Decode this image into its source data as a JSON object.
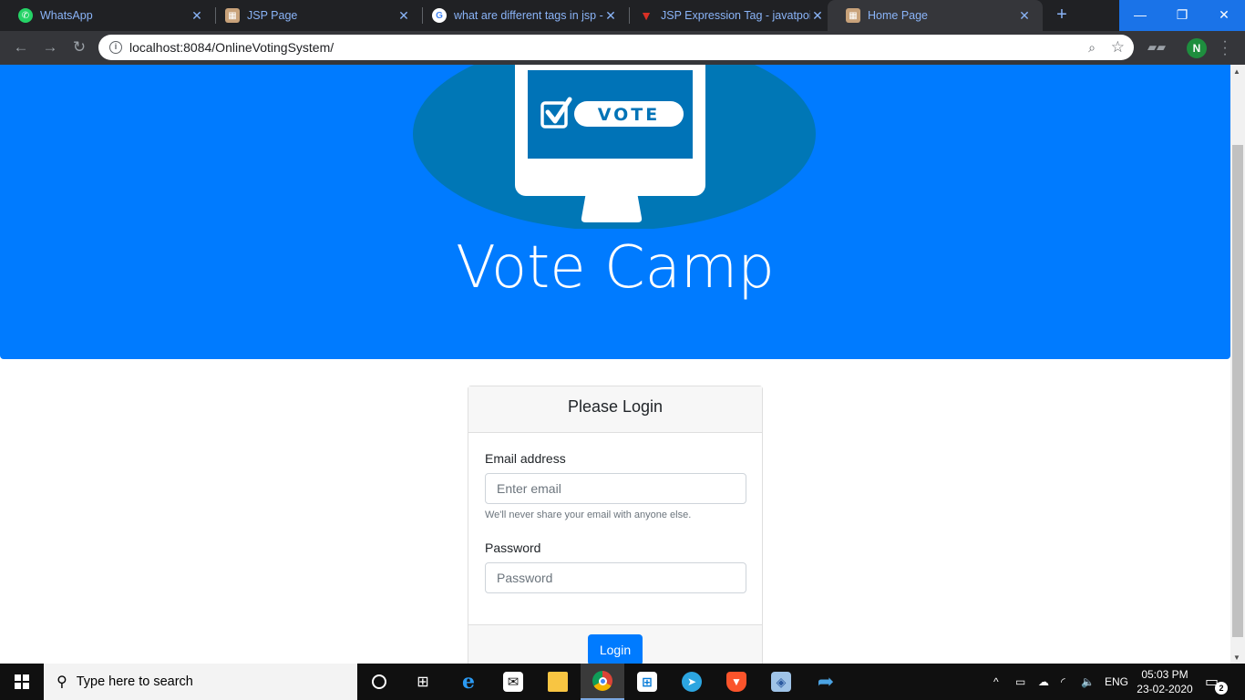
{
  "browser": {
    "tabs": [
      {
        "title": "WhatsApp",
        "icon": "whatsapp-icon",
        "color": "#25d366"
      },
      {
        "title": "JSP Page",
        "icon": "page-icon",
        "color": "#c8a27a"
      },
      {
        "title": "what are different tags in jsp -",
        "icon": "google-icon",
        "color": "#ffffff"
      },
      {
        "title": "JSP Expression Tag - javatpoint",
        "icon": "javatpoint-icon",
        "color": "#d93025"
      },
      {
        "title": "Home Page",
        "icon": "page-icon",
        "color": "#c8a27a"
      }
    ],
    "new_tab": "+",
    "window": {
      "minimize": "—",
      "maximize": "❐",
      "close": "✕"
    },
    "address": {
      "url": "localhost:8084/OnlineVotingSystem/"
    },
    "profile_initial": "N"
  },
  "page": {
    "logo_text": "VOTE",
    "brand": "Vote Camp",
    "login": {
      "header": "Please Login",
      "email_label": "Email address",
      "email_placeholder": "Enter email",
      "email_help": "We'll never share your email with anyone else.",
      "password_label": "Password",
      "password_placeholder": "Password",
      "submit_label": "Login"
    },
    "colors": {
      "primary": "#007bff",
      "logo_oval": "#0077b6",
      "screen": "#0073b7"
    }
  },
  "taskbar": {
    "search_placeholder": "Type here to search",
    "apps": [
      "task-view-icon",
      "cortana-icon",
      "edge-icon",
      "mail-icon",
      "file-explorer-icon",
      "chrome-icon",
      "store-icon",
      "telegram-icon",
      "brave-icon",
      "virtualbox-icon",
      "netbeans-icon"
    ],
    "tray": {
      "language": "ENG",
      "time": "05:03 PM",
      "date": "23-02-2020",
      "notifications": "2"
    }
  }
}
